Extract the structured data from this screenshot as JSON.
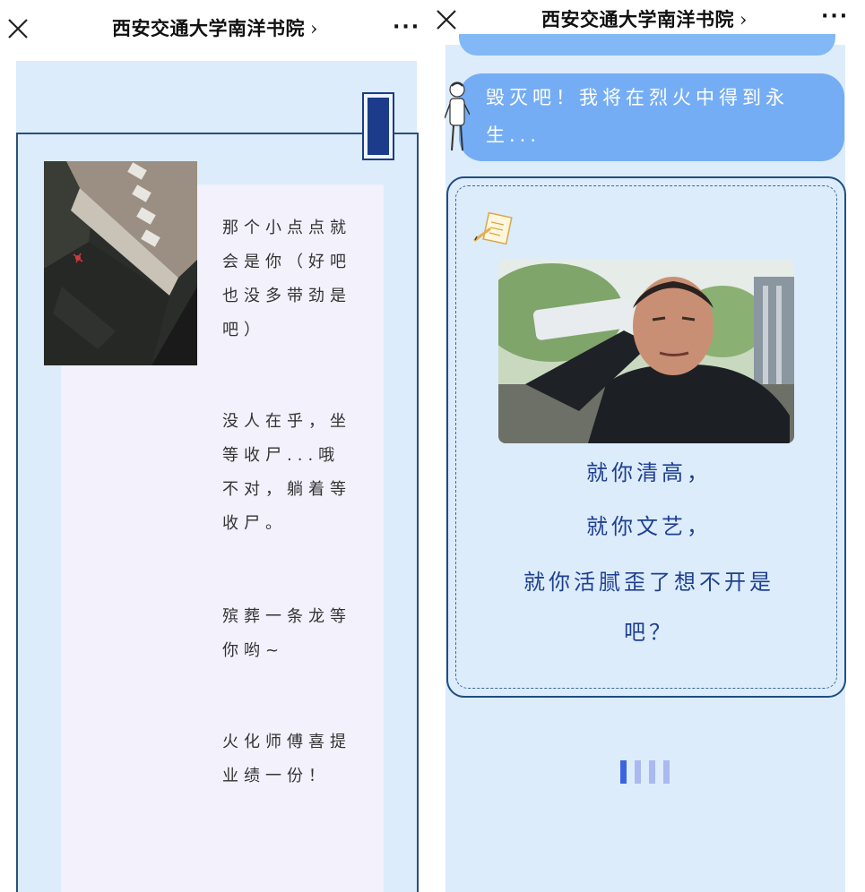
{
  "left_screen": {
    "nav": {
      "title": "西安交通大学南洋书院",
      "chevron": "›",
      "more": "···"
    },
    "paragraphs": [
      "那个小点点就会是你（好吧也没多带劲是吧）",
      "没人在乎，坐等收尸...哦不对，躺着等收尸。",
      "殡葬一条龙等你哟~",
      "火化师傅喜提业绩一份！"
    ]
  },
  "right_screen": {
    "nav": {
      "title": "西安交通大学南洋书院",
      "chevron": "›",
      "more": "···"
    },
    "bubble_text": "毁灭吧！我将在烈火中得到永生...",
    "lines": [
      "就你清高，",
      "就你文艺，",
      "就你活腻歪了想不开是",
      "吧？"
    ]
  },
  "colors": {
    "page_blue": "#dcecfb",
    "frame_navy": "#2a4f7a",
    "bubble_blue": "#75adf4",
    "text_navy": "#1f3f90",
    "loader_dark": "#3a64e0",
    "loader_light": "#aab9f0"
  },
  "icons": [
    "close-icon",
    "more-icon",
    "chevron-right-icon",
    "note-sticker-icon",
    "avatar-figure-icon",
    "loading-indicator-icon"
  ]
}
